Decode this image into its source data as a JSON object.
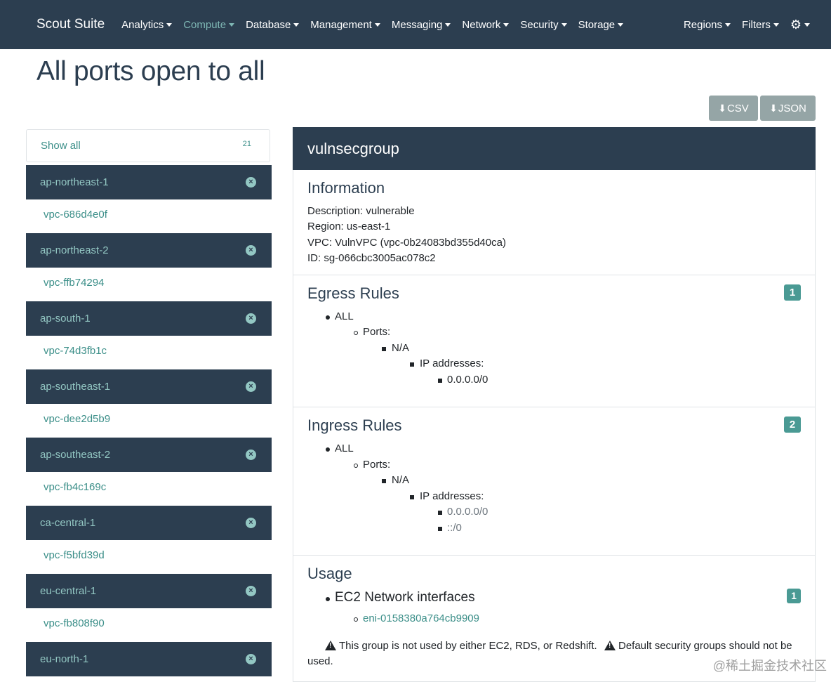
{
  "nav": {
    "brand": "Scout Suite",
    "items": [
      {
        "label": "Analytics",
        "active": false
      },
      {
        "label": "Compute",
        "active": true
      },
      {
        "label": "Database",
        "active": false
      },
      {
        "label": "Management",
        "active": false
      },
      {
        "label": "Messaging",
        "active": false
      },
      {
        "label": "Network",
        "active": false
      },
      {
        "label": "Security",
        "active": false
      },
      {
        "label": "Storage",
        "active": false
      }
    ],
    "right": [
      {
        "label": "Regions"
      },
      {
        "label": "Filters"
      }
    ],
    "settings_icon": "gear-icon"
  },
  "page": {
    "title": "All ports open to all"
  },
  "export": {
    "csv_label": "CSV",
    "json_label": "JSON"
  },
  "sidebar": {
    "show_all": {
      "label": "Show all",
      "count": "21"
    },
    "regions": [
      {
        "name": "ap-northeast-1",
        "vpc": "vpc-686d4e0f"
      },
      {
        "name": "ap-northeast-2",
        "vpc": "vpc-ffb74294"
      },
      {
        "name": "ap-south-1",
        "vpc": "vpc-74d3fb1c"
      },
      {
        "name": "ap-southeast-1",
        "vpc": "vpc-dee2d5b9"
      },
      {
        "name": "ap-southeast-2",
        "vpc": "vpc-fb4c169c"
      },
      {
        "name": "ca-central-1",
        "vpc": "vpc-f5bfd39d"
      },
      {
        "name": "eu-central-1",
        "vpc": "vpc-fb808f90"
      },
      {
        "name": "eu-north-1",
        "vpc": ""
      }
    ]
  },
  "detail": {
    "name": "vulnsecgroup",
    "information": {
      "title": "Information",
      "description": "Description: vulnerable",
      "region": "Region: us-east-1",
      "vpc": "VPC: VulnVPC (vpc-0b24083bd355d40ca)",
      "id": "ID: sg-066cbc3005ac078c2"
    },
    "egress": {
      "title": "Egress Rules",
      "count": "1",
      "protocol": "ALL",
      "ports_label": "Ports:",
      "ports_value": "N/A",
      "ip_label": "IP addresses:",
      "ips": [
        "0.0.0.0/0"
      ]
    },
    "ingress": {
      "title": "Ingress Rules",
      "count": "2",
      "protocol": "ALL",
      "ports_label": "Ports:",
      "ports_value": "N/A",
      "ip_label": "IP addresses:",
      "ips": [
        "0.0.0.0/0",
        "::/0"
      ]
    },
    "usage": {
      "title": "Usage",
      "ec2_label": "EC2 Network interfaces",
      "ec2_count": "1",
      "eni": "eni-0158380a764cb9909",
      "warning1": "This group is not used by either EC2, RDS, or Redshift.",
      "warning2": "Default security groups should not be",
      "warning2_cont": "used."
    }
  },
  "watermark": "@稀土掘金技术社区"
}
